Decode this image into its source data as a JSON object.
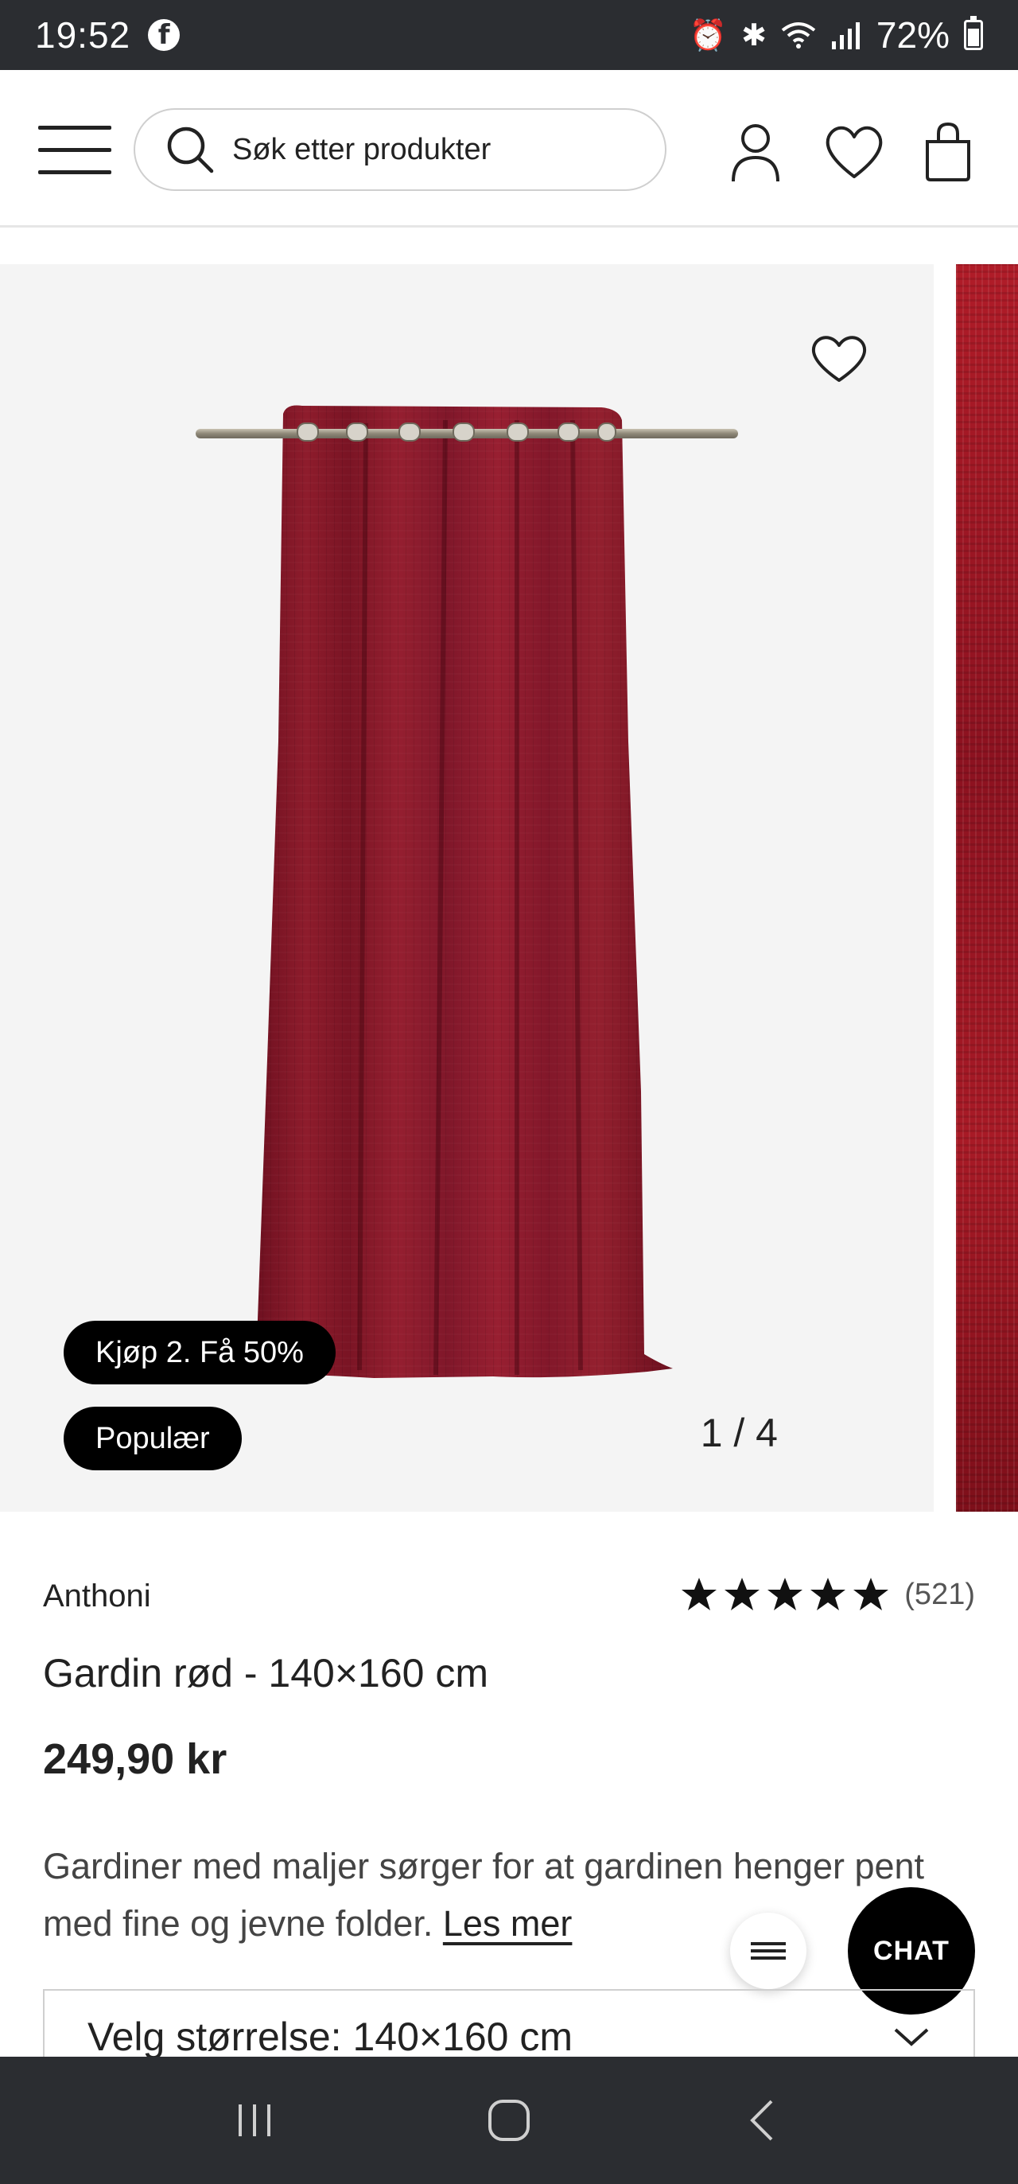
{
  "status_bar": {
    "time": "19:52",
    "app_icon": "f",
    "battery": "72%",
    "battery_level": 0.72,
    "icons": [
      "alarm-icon",
      "bluetooth-icon",
      "wifi-icon",
      "signal-icon"
    ]
  },
  "header": {
    "search_placeholder": "Søk etter produkter"
  },
  "gallery": {
    "badges": [
      "Kjøp 2. Få 50%",
      "Populær"
    ],
    "counter": "1 / 4"
  },
  "product": {
    "brand": "Anthoni",
    "rating_stars": 5,
    "rating_count": "(521)",
    "title": "Gardin rød - 140×160 cm",
    "price": "249,90 kr",
    "description": "Gardiner med maljer sørger for at gardinen henger pent med fine og jevne folder.",
    "read_more": "Les mer",
    "size_select": "Velg størrelse: 140×160 cm"
  },
  "chat_button": "CHAT",
  "colors": {
    "accent": "#000000",
    "curtain": "#8b1a2b",
    "background_image": "#f4f4f4"
  }
}
